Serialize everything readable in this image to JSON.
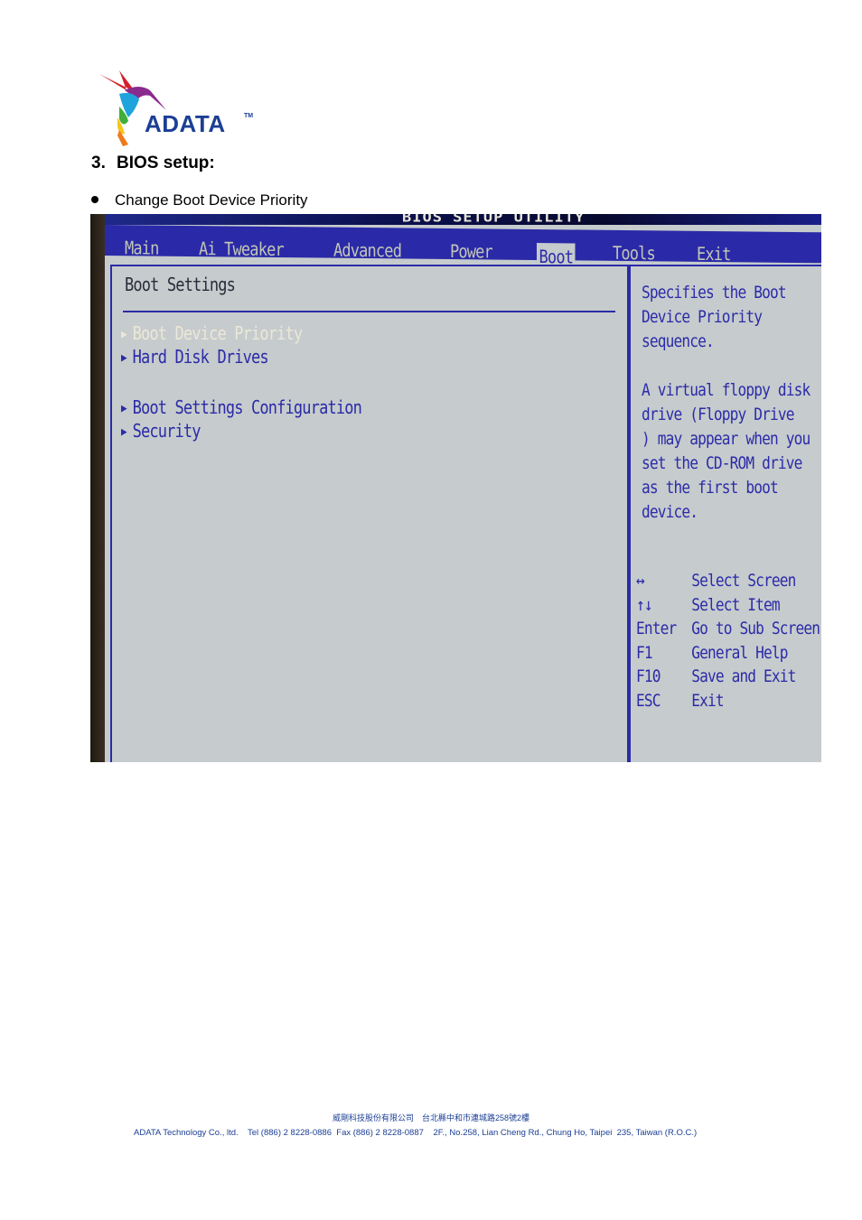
{
  "logo": {
    "brand": "ADATA",
    "trademark": "TM"
  },
  "section": {
    "number": "3.",
    "title": "BIOS setup:"
  },
  "bullets": [
    "Change Boot Device Priority"
  ],
  "bios": {
    "title": "BIOS SETUP UTILITY",
    "menu": [
      {
        "label": "Main",
        "active": false
      },
      {
        "label": "Ai Tweaker",
        "active": false
      },
      {
        "label": "Advanced",
        "active": false
      },
      {
        "label": "Power",
        "active": false
      },
      {
        "label": "Boot",
        "active": true
      },
      {
        "label": "Tools",
        "active": false
      },
      {
        "label": "Exit",
        "active": false
      }
    ],
    "section_title": "Boot Settings",
    "items": [
      {
        "label": "Boot Device Priority",
        "selected": true
      },
      {
        "label": "Hard Disk Drives",
        "selected": false
      },
      {
        "label": "Boot Settings Configuration",
        "selected": false
      },
      {
        "label": "Security",
        "selected": false
      }
    ],
    "help": [
      "Specifies the Boot",
      "Device Priority",
      "sequence.",
      "",
      "A virtual floppy disk",
      "drive (Floppy Drive",
      ") may appear when you",
      "set the CD-ROM drive",
      "as the first boot",
      "device."
    ],
    "keys": [
      {
        "key": "↔",
        "action": "Select Screen"
      },
      {
        "key": "↑↓",
        "action": "Select Item"
      },
      {
        "key": "Enter",
        "action": "Go to Sub Screen"
      },
      {
        "key": "F1",
        "action": "General Help"
      },
      {
        "key": "F10",
        "action": "Save and Exit"
      },
      {
        "key": "ESC",
        "action": "Exit"
      }
    ]
  },
  "footer": {
    "chinese": "威剛科技股份有限公司　台北縣中和市連城路258號2樓",
    "english": "ADATA Technology Co., ltd.    Tel (886) 2 8228-0886  Fax (886) 2 8228-0887    2F., No.258, Lian Cheng Rd., Chung Ho, Taipei  235, Taiwan (R.O.C.)"
  },
  "colors": {
    "bios_blue": "#2b2ba8",
    "bios_gray": "#c6cbcd",
    "brand_blue": "#1b3f94"
  }
}
